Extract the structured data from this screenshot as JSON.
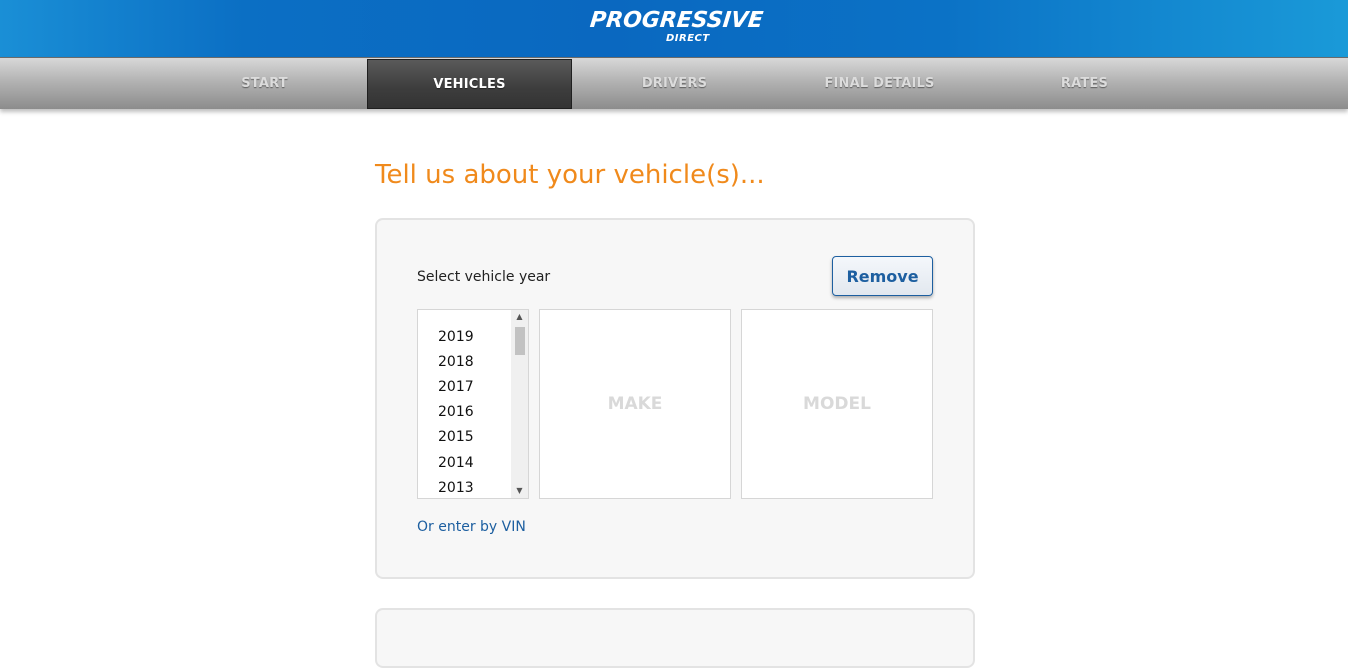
{
  "brand": {
    "name": "PROGRESSIVE",
    "sub": "DIRECT",
    "registered": "®"
  },
  "nav": {
    "items": [
      {
        "label": "START",
        "active": false
      },
      {
        "label": "VEHICLES",
        "active": true
      },
      {
        "label": "DRIVERS",
        "active": false
      },
      {
        "label": "FINAL DETAILS",
        "active": false
      },
      {
        "label": "RATES",
        "active": false
      }
    ]
  },
  "main": {
    "title": "Tell us about your vehicle(s)...",
    "vehicle": {
      "year_label": "Select vehicle year",
      "remove_label": "Remove",
      "years": [
        "2019",
        "2018",
        "2017",
        "2016",
        "2015",
        "2014",
        "2013"
      ],
      "make_placeholder": "MAKE",
      "model_placeholder": "MODEL",
      "vin_link": "Or enter by VIN"
    }
  },
  "colors": {
    "header_blue": "#0b6fc4",
    "title_orange": "#f08a1c",
    "link_blue": "#1d5fa0"
  }
}
